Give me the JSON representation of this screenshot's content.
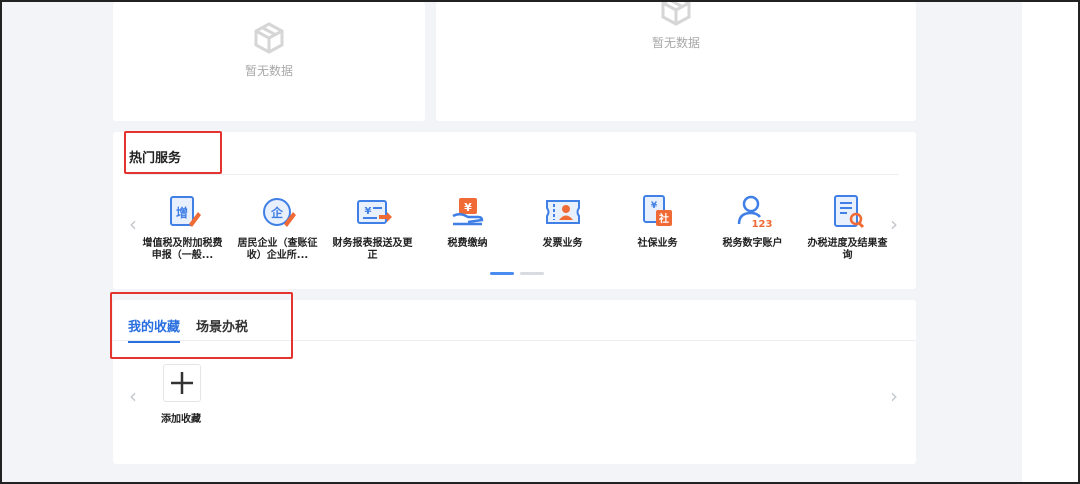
{
  "empty_cards": [
    {
      "text": "暂无数据"
    },
    {
      "text": "暂无数据"
    }
  ],
  "hot_services": {
    "title": "热门服务",
    "items": [
      {
        "label": "增值税及附加税费申报（一般..."
      },
      {
        "label": "居民企业（查账征收）企业所..."
      },
      {
        "label": "财务报表报送及更正"
      },
      {
        "label": "税费缴纳"
      },
      {
        "label": "发票业务"
      },
      {
        "label": "社保业务"
      },
      {
        "label": "税务数字账户"
      },
      {
        "label": "办税进度及结果查询"
      }
    ],
    "prev_arrow": "‹",
    "next_arrow": "›"
  },
  "favorites": {
    "tabs": [
      {
        "label": "我的收藏",
        "active": true
      },
      {
        "label": "场景办税",
        "active": false
      }
    ],
    "add_label": "添加收藏",
    "prev_arrow": "‹",
    "next_arrow": "›"
  },
  "colors": {
    "accent": "#2a6fe0",
    "icon_blue": "#3f7fe6",
    "icon_orange": "#f06a35",
    "highlight_red": "#e3342f"
  }
}
